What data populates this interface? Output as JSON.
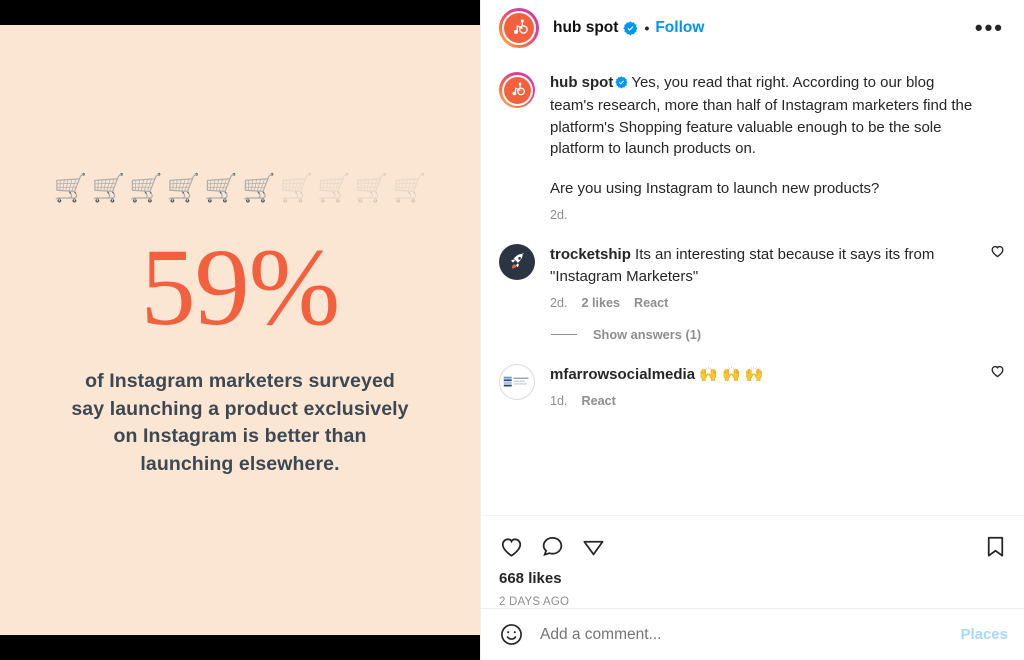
{
  "media": {
    "background_color": "#fae6d3",
    "stat_color": "#f4603e",
    "stat_value": "59%",
    "carts": [
      {
        "icon": "shopping-cart-emoji",
        "filled": true
      },
      {
        "icon": "shopping-cart-emoji",
        "filled": true
      },
      {
        "icon": "shopping-cart-emoji",
        "filled": true
      },
      {
        "icon": "shopping-cart-emoji",
        "filled": true
      },
      {
        "icon": "shopping-cart-emoji",
        "filled": true
      },
      {
        "icon": "shopping-cart-emoji",
        "filled": true
      },
      {
        "icon": "shopping-cart-emoji",
        "filled": false
      },
      {
        "icon": "shopping-cart-emoji",
        "filled": false
      },
      {
        "icon": "shopping-cart-emoji",
        "filled": false
      },
      {
        "icon": "shopping-cart-emoji",
        "filled": false
      }
    ],
    "caption_lines": [
      "of Instagram marketers surveyed",
      "say launching a product exclusively",
      "on Instagram is better than",
      "launching elsewhere."
    ]
  },
  "header": {
    "username": "hub spot",
    "verified_icon": "verified-badge-icon",
    "separator": "•",
    "follow_label": "Follow",
    "more_icon": "more-options-icon",
    "avatar_icon": "hubspot-logo-icon"
  },
  "caption": {
    "username": "hub spot",
    "verified_icon": "verified-badge-icon",
    "paragraph_1": "Yes, you read that right. According to our blog team's research, more than half of Instagram marketers find the platform's Shopping feature valuable enough to be the sole platform to launch products on.",
    "paragraph_2": "Are you using Instagram to launch new products?",
    "time": "2d."
  },
  "comments": [
    {
      "username": "trocketship",
      "avatar_icon": "rocket-avatar-icon",
      "text": "Its an interesting stat because it says its from \"Instagram Marketers\"",
      "time": "2d.",
      "likes": "2 likes",
      "react_label": "React",
      "like_icon": "heart-outline-icon",
      "show_answers_label": "Show answers (1)"
    },
    {
      "username": "mfarrowsocialmedia",
      "avatar_icon": "mfarrow-logo-avatar-icon",
      "text": "🙌 🙌 🙌",
      "time": "1d.",
      "likes": "",
      "react_label": "React",
      "like_icon": "heart-outline-icon"
    }
  ],
  "actions": {
    "like_icon": "heart-outline-icon",
    "comment_icon": "comment-bubble-icon",
    "share_icon": "share-paper-plane-icon",
    "save_icon": "bookmark-outline-icon",
    "likes_count": "668 likes",
    "timestamp": "2 DAYS AGO"
  },
  "composer": {
    "emoji_icon": "emoji-smiley-icon",
    "placeholder": "Add a comment...",
    "places_label": "Places"
  },
  "colors": {
    "instagram_blue": "#0095f6",
    "places_blue": "#a8d8fb",
    "muted_gray": "#8e8e8e"
  }
}
